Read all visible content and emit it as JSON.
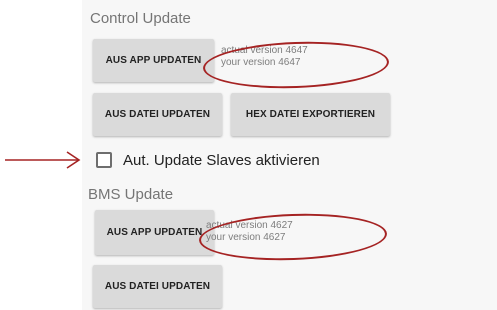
{
  "control_update": {
    "title": "Control Update",
    "app_update_button": "AUS APP UPDATEN",
    "actual_version": "actual version 4647",
    "your_version": "your version 4647",
    "file_update_button": "AUS DATEI UPDATEN",
    "hex_export_button": "HEX DATEI EXPORTIEREN"
  },
  "auto_update_slaves": {
    "label": "Aut. Update Slaves aktivieren",
    "checked": false
  },
  "bms_update": {
    "title": "BMS Update",
    "app_update_button": "AUS APP UPDATEN",
    "actual_version": "actual version 4627",
    "your_version": "your version 4627",
    "file_update_button": "AUS DATEI UPDATEN"
  },
  "annotations": {
    "color": "#a52323",
    "arrow_target": "checkbox-auto-update-slaves"
  }
}
